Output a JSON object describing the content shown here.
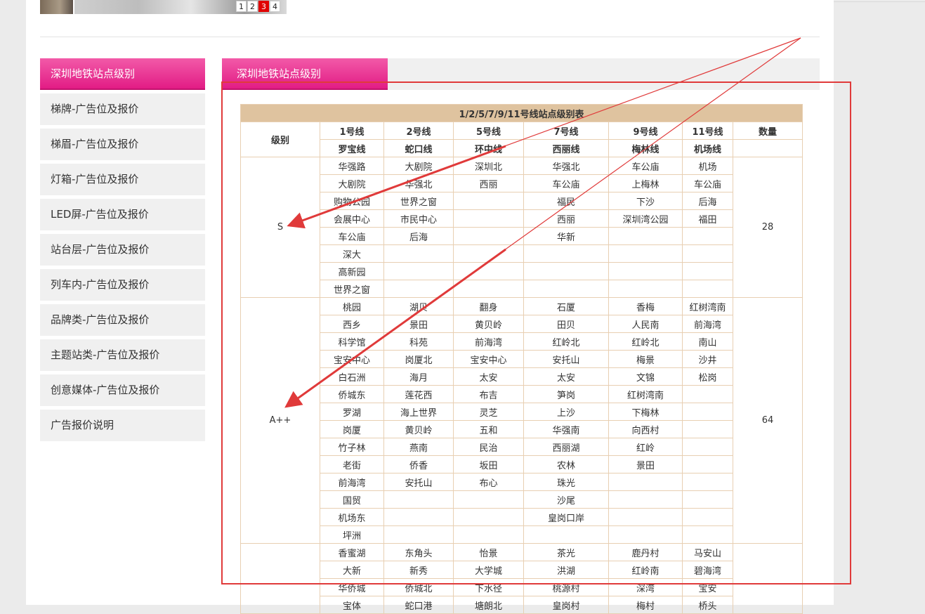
{
  "carousel": {
    "pages": [
      "1",
      "2",
      "3",
      "4"
    ],
    "active_page": "3"
  },
  "sidebar": {
    "heading": "深圳地铁站点级别",
    "items": [
      {
        "label": "梯牌-广告位及报价"
      },
      {
        "label": "梯眉-广告位及报价"
      },
      {
        "label": "灯箱-广告位及报价"
      },
      {
        "label": "LED屏-广告位及报价"
      },
      {
        "label": "站台层-广告位及报价"
      },
      {
        "label": "列车内-广告位及报价"
      },
      {
        "label": "品牌类-广告位及报价"
      },
      {
        "label": "主题站类-广告位及报价"
      },
      {
        "label": "创意媒体-广告位及报价"
      },
      {
        "label": "广告报价说明"
      }
    ]
  },
  "main": {
    "tab_title": "深圳地铁站点级别",
    "table": {
      "title": "1/2/5/7/9/11号线站点级别表",
      "level_header": "级别",
      "count_header": "数量",
      "lines": [
        "1号线",
        "2号线",
        "5号线",
        "7号线",
        "9号线",
        "11号线"
      ],
      "line_names": [
        "罗宝线",
        "蛇口线",
        "环中线",
        "西丽线",
        "梅林线",
        "机场线"
      ],
      "groups": [
        {
          "level": "S",
          "count": "28",
          "rows": [
            [
              "华强路",
              "大剧院",
              "深圳北",
              "华强北",
              "车公庙",
              "机场"
            ],
            [
              "大剧院",
              "华强北",
              "西丽",
              "车公庙",
              "上梅林",
              "车公庙"
            ],
            [
              "购物公园",
              "世界之窗",
              "",
              "福民",
              "下沙",
              "后海"
            ],
            [
              "会展中心",
              "市民中心",
              "",
              "西丽",
              "深圳湾公园",
              "福田"
            ],
            [
              "车公庙",
              "后海",
              "",
              "华新",
              "",
              ""
            ],
            [
              "深大",
              "",
              "",
              "",
              "",
              ""
            ],
            [
              "高新园",
              "",
              "",
              "",
              "",
              ""
            ],
            [
              "世界之窗",
              "",
              "",
              "",
              "",
              ""
            ]
          ]
        },
        {
          "level": "A++",
          "count": "64",
          "rows": [
            [
              "桃园",
              "湖贝",
              "翻身",
              "石厦",
              "香梅",
              "红树湾南"
            ],
            [
              "西乡",
              "景田",
              "黄贝岭",
              "田贝",
              "人民南",
              "前海湾"
            ],
            [
              "科学馆",
              "科苑",
              "前海湾",
              "红岭北",
              "红岭北",
              "南山"
            ],
            [
              "宝安中心",
              "岗厦北",
              "宝安中心",
              "安托山",
              "梅景",
              "沙井"
            ],
            [
              "白石洲",
              "海月",
              "太安",
              "太安",
              "文锦",
              "松岗"
            ],
            [
              "侨城东",
              "莲花西",
              "布吉",
              "笋岗",
              "红树湾南",
              ""
            ],
            [
              "罗湖",
              "海上世界",
              "灵芝",
              "上沙",
              "下梅林",
              ""
            ],
            [
              "岗厦",
              "黄贝岭",
              "五和",
              "华强南",
              "向西村",
              ""
            ],
            [
              "竹子林",
              "燕南",
              "民治",
              "西丽湖",
              "红岭",
              ""
            ],
            [
              "老街",
              "侨香",
              "坂田",
              "农林",
              "景田",
              ""
            ],
            [
              "前海湾",
              "安托山",
              "布心",
              "珠光",
              "",
              ""
            ],
            [
              "国贸",
              "",
              "",
              "沙尾",
              "",
              ""
            ],
            [
              "机场东",
              "",
              "",
              "皇岗口岸",
              "",
              ""
            ],
            [
              "坪洲",
              "",
              "",
              "",
              "",
              ""
            ]
          ]
        },
        {
          "level": "",
          "count": "",
          "rows": [
            [
              "香蜜湖",
              "东角头",
              "怡景",
              "茶光",
              "鹿丹村",
              "马安山"
            ],
            [
              "大新",
              "新秀",
              "大学城",
              "洪湖",
              "红岭南",
              "碧海湾"
            ],
            [
              "华侨城",
              "侨城北",
              "下水径",
              "桃源村",
              "深湾",
              "宝安"
            ],
            [
              "宝体",
              "蛇口港",
              "塘朗北",
              "皇岗村",
              "梅村",
              "桥头"
            ]
          ]
        }
      ]
    }
  },
  "annotation": {
    "color": "#e03a3a"
  }
}
